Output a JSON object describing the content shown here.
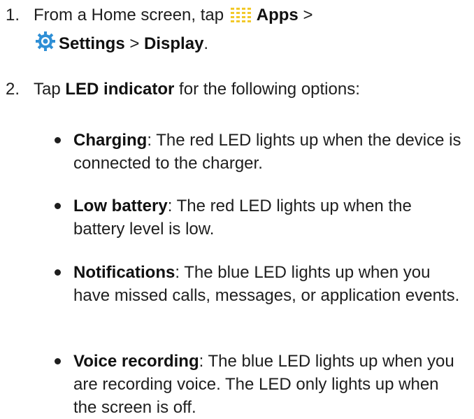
{
  "step1": {
    "num": "1.",
    "text1": "From a Home screen, tap",
    "apps": "Apps",
    "sep1": " >",
    "settings": "Settings",
    "sep2": " > ",
    "display": "Display",
    "end": "."
  },
  "step2": {
    "num": "2.",
    "text1": "Tap ",
    "led": "LED indicator",
    "text2": " for the following options:"
  },
  "bullets": [
    {
      "term": "Charging",
      "text": ": The red LED lights up when the device is connected to the charger."
    },
    {
      "term": "Low battery",
      "text": ": The red LED lights up when the battery level is low."
    },
    {
      "term": "Notifications",
      "text": ": The blue LED lights up when you have missed calls, messages, or application events."
    },
    {
      "term": "Voice recording",
      "text": ": The blue LED lights up when you are recording voice. The LED only lights up when the screen is off."
    }
  ],
  "colors": {
    "text": "#1e1e1e",
    "icon_grid": "#f2c92a",
    "icon_gear": "#2f8fd6"
  },
  "icons": [
    "apps-grid-icon",
    "settings-gear-icon"
  ]
}
